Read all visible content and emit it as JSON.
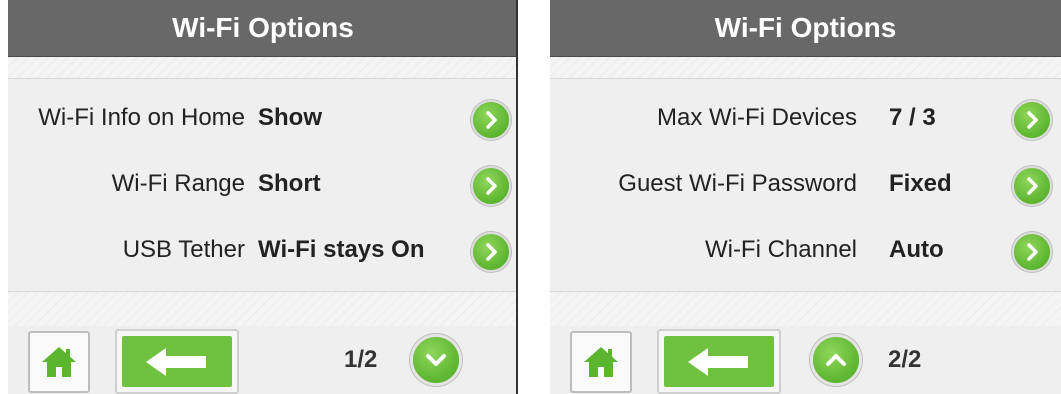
{
  "screens": [
    {
      "title": "Wi-Fi Options",
      "rows": [
        {
          "label": "Wi-Fi Info on Home",
          "value": "Show"
        },
        {
          "label": "Wi-Fi Range",
          "value": "Short"
        },
        {
          "label": "USB Tether",
          "value": "Wi-Fi stays On"
        }
      ],
      "page_indicator": "1/2",
      "page_button_icon": "chevron-down-icon"
    },
    {
      "title": "Wi-Fi Options",
      "rows": [
        {
          "label": "Max Wi-Fi Devices",
          "value": "7 / 3"
        },
        {
          "label": "Guest Wi-Fi Password",
          "value": "Fixed"
        },
        {
          "label": "Wi-Fi Channel",
          "value": "Auto"
        }
      ],
      "page_indicator": "2/2",
      "page_button_icon": "chevron-up-icon"
    }
  ],
  "icons": {
    "row_button": "chevron-right-icon",
    "home": "home-icon",
    "back": "arrow-left-icon"
  },
  "colors": {
    "title_bar": "#686868",
    "accent_green": "#6fc23f",
    "background": "#efefef"
  }
}
